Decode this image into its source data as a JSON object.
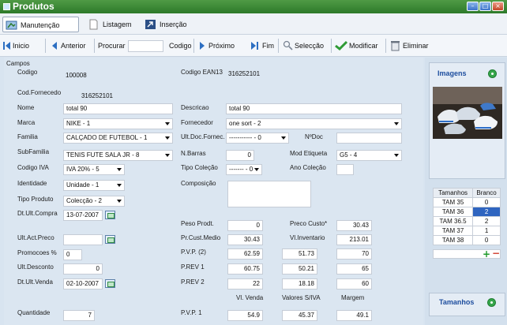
{
  "window": {
    "title": "Produtos"
  },
  "tabs": [
    {
      "label": "Manutenção",
      "icon": "maintenance-icon"
    },
    {
      "label": "Listagem",
      "icon": "document-icon"
    },
    {
      "label": "Inserção",
      "icon": "insert-icon"
    }
  ],
  "toolbar": {
    "inicio": "Inicio",
    "anterior": "Anterior",
    "procurar": "Procurar",
    "procurar_value": "",
    "codigo": "Codigo",
    "proximo": "Próximo",
    "fim": "Fim",
    "seleccao": "Selecção",
    "modificar": "Modificar",
    "eliminar": "Eliminar"
  },
  "section": {
    "campos": "Campos"
  },
  "fields": {
    "codigo": {
      "label": "Codigo",
      "value": "100008"
    },
    "ean13": {
      "label": "Codigo EAN13",
      "value": "316252101"
    },
    "cod_fornecedo": {
      "label": "Cod.Fornecedo",
      "value": "316252101"
    },
    "nome": {
      "label": "Nome",
      "value": "total 90"
    },
    "descricao": {
      "label": "Descricao",
      "value": "total 90"
    },
    "marca": {
      "label": "Marca",
      "value": "NIKE - 1"
    },
    "fornecedor": {
      "label": "Fornecedor",
      "value": "one sort - 2"
    },
    "familia": {
      "label": "Familia",
      "value": "CALÇADO DE FUTEBOL - 1"
    },
    "ult_doc_fornec": {
      "label": "Ult.Doc.Fornec.",
      "value": "----------- - 0"
    },
    "n_doc": {
      "label": "NºDoc",
      "value": ""
    },
    "subfamilia": {
      "label": "SubFamilia",
      "value": "TENIS FUTE SALA JR - 8"
    },
    "n_barras": {
      "label": "N.Barras",
      "value": "0"
    },
    "mod_etiqueta": {
      "label": "Mod Etiqueta",
      "value": "G5 - 4"
    },
    "codigo_iva": {
      "label": "Codigo IVA",
      "value": "IVA 20% - 5"
    },
    "tipo_colecao": {
      "label": "Tipo Coleção",
      "value": "------- - 0"
    },
    "ano_colecao": {
      "label": "Ano Coleção",
      "value": ""
    },
    "identidade": {
      "label": "Identidade",
      "value": "Unidade - 1"
    },
    "composicao": {
      "label": "Composição",
      "value": ""
    },
    "tipo_produto": {
      "label": "Tipo Produto",
      "value": "Colecção - 2"
    },
    "dt_ult_compra": {
      "label": "Dt.Ult.Compra",
      "value": "13-07-2007"
    },
    "peso_prodt": {
      "label": "Peso Prodt.",
      "value": "0"
    },
    "preco_custo": {
      "label": "Preco Custo*",
      "value": "30.43"
    },
    "ult_act_preco": {
      "label": "Ult.Act.Preco",
      "value": ""
    },
    "pr_cust_medio": {
      "label": "Pr.Cust.Medio",
      "value": "30.43"
    },
    "vl_inventario": {
      "label": "Vl.Inventario",
      "value": "213.01"
    },
    "promocoes": {
      "label": "Promocoes %",
      "value": "0"
    },
    "pvp2": {
      "label": "P.V.P. (2)",
      "v1": "62.59",
      "v2": "51.73",
      "v3": "70"
    },
    "ult_desconto": {
      "label": "Ult.Desconto",
      "value": "0"
    },
    "prev1": {
      "label": "P.REV 1",
      "v1": "60.75",
      "v2": "50.21",
      "v3": "65"
    },
    "dt_ult_venda": {
      "label": "Dt.Ult.Venda",
      "value": "02-10-2007"
    },
    "prev2": {
      "label": "P.REV 2",
      "v1": "22",
      "v2": "18.18",
      "v3": "60"
    },
    "quantidade": {
      "label": "Quantidade",
      "value": "7"
    },
    "pvp1": {
      "label": "P.V.P. 1",
      "v1": "54.9",
      "v2": "45.37",
      "v3": "49.1"
    }
  },
  "price_headers": {
    "venda": "Vl. Venda",
    "siva": "Valores S/IVA",
    "margem": "Margem"
  },
  "side": {
    "imagens": "Imagens",
    "tamanhos": "Tamanhos",
    "sizes_header": [
      "Tamanhos",
      "Branco"
    ],
    "sizes": [
      {
        "size": "TAM 35",
        "qty": "0"
      },
      {
        "size": "TAM 36",
        "qty": "2"
      },
      {
        "size": "TAM 36.5",
        "qty": "2"
      },
      {
        "size": "TAM 37",
        "qty": "1"
      },
      {
        "size": "TAM 38",
        "qty": "0"
      }
    ]
  },
  "colors": {
    "titlebar": "#3d8a38",
    "selected": "#2f65c0",
    "accent_green": "#36a64b"
  }
}
